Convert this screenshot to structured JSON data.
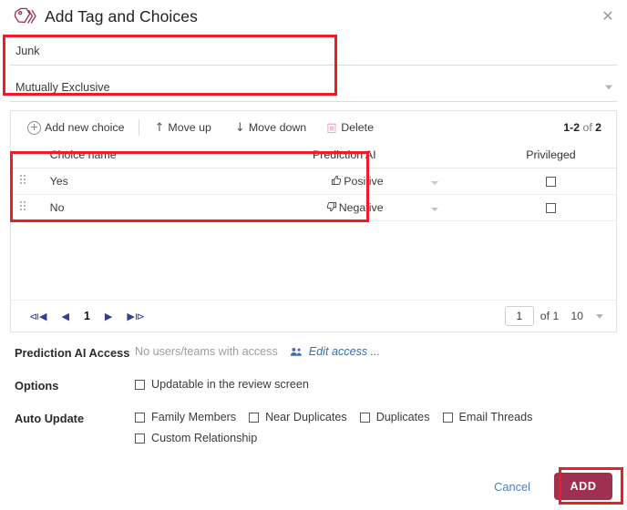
{
  "dialog": {
    "title": "Add Tag and Choices",
    "title_icon": "tags-icon",
    "close_icon": "close-icon"
  },
  "fields": [
    {
      "name": "tag-name",
      "value": "Junk",
      "has_caret": false
    },
    {
      "name": "tag-type",
      "value": "Mutually Exclusive",
      "has_caret": true
    }
  ],
  "toolbar": {
    "add_choice": "Add new choice",
    "add_choice_icon": "circle-plus-icon",
    "move_up": "Move up",
    "move_up_icon": "arrow-up-icon",
    "move_down": "Move down",
    "move_down_icon": "arrow-down-icon",
    "delete": "Delete",
    "delete_icon": "trash-icon",
    "count_range": "1-2",
    "count_of": " of ",
    "count_total": "2"
  },
  "table": {
    "headers": {
      "handle": "",
      "choice_name": "Choice name",
      "prediction_ai": "Prediction AI",
      "caret": "",
      "privileged": "Privileged"
    },
    "rows": [
      {
        "choice_name": "Yes",
        "prediction": "Positive",
        "prediction_icon": "thumbs-up-icon",
        "privileged_checked": false
      },
      {
        "choice_name": "No",
        "prediction": "Negative",
        "prediction_icon": "thumbs-down-icon",
        "privileged_checked": false
      }
    ]
  },
  "pagination": {
    "first_icon": "⧏◀",
    "prev_icon": "◀",
    "current_page": "1",
    "next_icon": "▶",
    "last_icon": "▶⧐",
    "page_input_value": "1",
    "of_label": "of 1",
    "page_size": "10",
    "page_size_caret": "chevron-down-icon"
  },
  "prediction_access": {
    "label": "Prediction AI Access",
    "value": "No users/teams with access",
    "edit_link": "Edit access ...",
    "edit_icon": "people-icon"
  },
  "options": {
    "label": "Options",
    "items": [
      {
        "label": "Updatable in the review screen",
        "checked": false
      }
    ]
  },
  "auto_update": {
    "label": "Auto Update",
    "row1": [
      {
        "label": "Family Members",
        "checked": false
      },
      {
        "label": "Near Duplicates",
        "checked": false
      },
      {
        "label": "Duplicates",
        "checked": false
      },
      {
        "label": "Email Threads",
        "checked": false
      }
    ],
    "row2": [
      {
        "label": "Custom Relationship",
        "checked": false
      }
    ]
  },
  "footer": {
    "cancel": "Cancel",
    "add": "ADD"
  },
  "colors": {
    "accent_maroon": "#9e3151",
    "annotation_red": "#ee1c25",
    "link_blue": "#4a7fbf",
    "pager_blue": "#2f3f9e",
    "muted_gray": "#9d9d9d"
  }
}
